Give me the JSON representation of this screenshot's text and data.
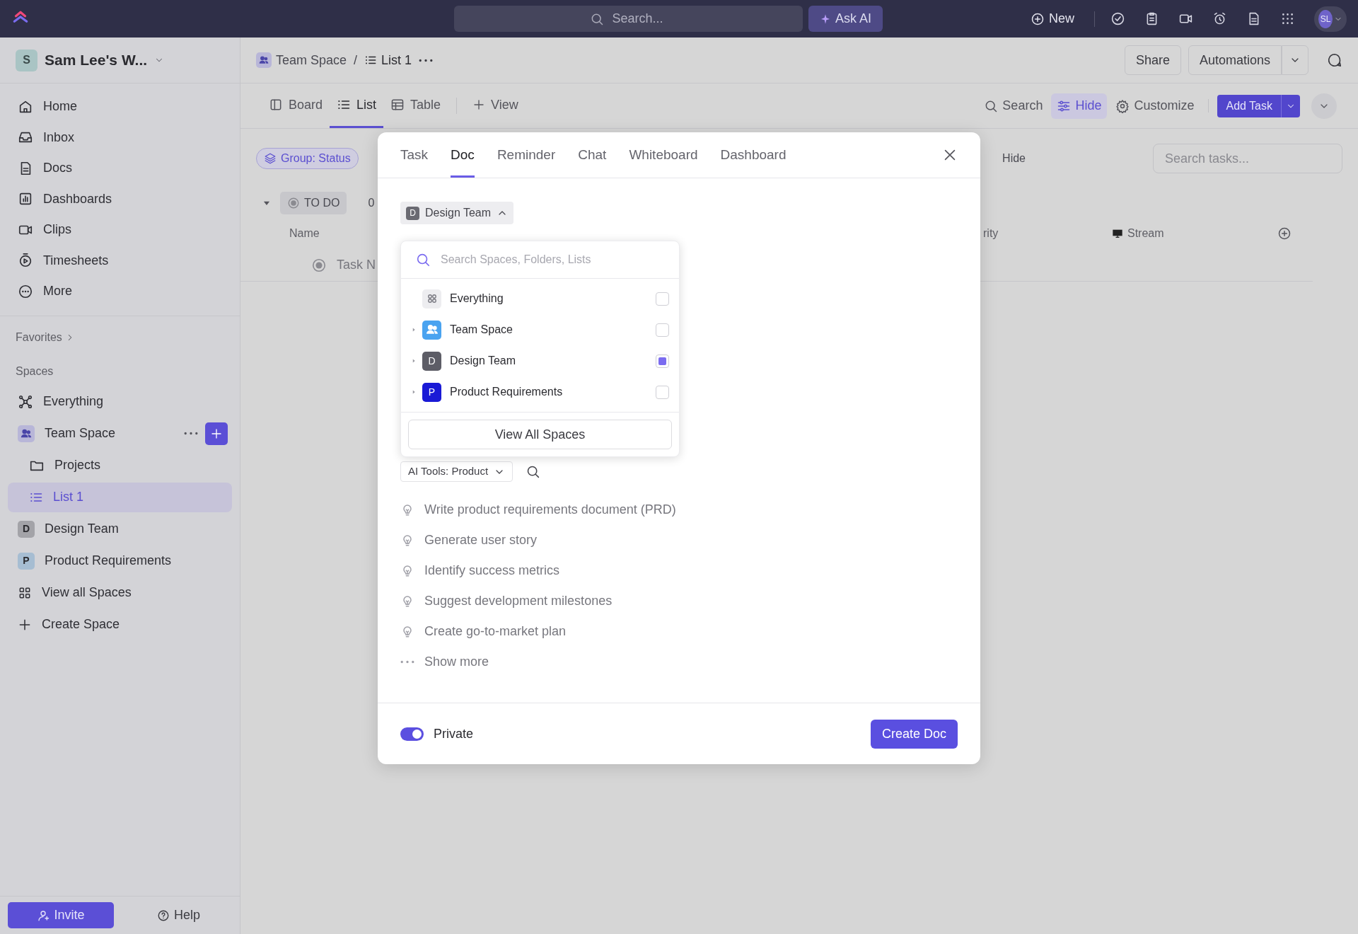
{
  "topbar": {
    "search": {
      "placeholder": "Search..."
    },
    "ask_ai": "Ask AI",
    "new": "New",
    "avatar": "SL"
  },
  "sidebar": {
    "workspace": {
      "initial": "S",
      "name": "Sam Lee's W..."
    },
    "nav": [
      {
        "label": "Home"
      },
      {
        "label": "Inbox"
      },
      {
        "label": "Docs"
      },
      {
        "label": "Dashboards"
      },
      {
        "label": "Clips"
      },
      {
        "label": "Timesheets"
      },
      {
        "label": "More"
      }
    ],
    "favorites": "Favorites",
    "spaces_heading": "Spaces",
    "spaces": [
      {
        "label": "Everything",
        "kind": "everything",
        "selected": false
      },
      {
        "label": "Team Space",
        "kind": "team",
        "selected": false,
        "children": [
          {
            "label": "Projects",
            "kind": "folder",
            "selected": false
          },
          {
            "label": "List 1",
            "kind": "list",
            "selected": true
          }
        ]
      },
      {
        "label": "Design Team",
        "kind": "avatar",
        "initial": "D",
        "color": "#a3a3a8",
        "selected": false
      },
      {
        "label": "Product Requirements",
        "kind": "avatar",
        "initial": "P",
        "color": "#a6bdd2",
        "selected": false
      },
      {
        "label": "View all Spaces",
        "kind": "grid",
        "selected": false
      },
      {
        "label": "Create Space",
        "kind": "plus",
        "selected": false
      }
    ],
    "invite": "Invite",
    "help": "Help"
  },
  "header": {
    "breadcrumb": [
      "Team Space",
      "List 1"
    ],
    "separator": "/",
    "share": "Share",
    "automations": "Automations"
  },
  "views": {
    "tabs": [
      {
        "label": "Board",
        "selected": false
      },
      {
        "label": "List",
        "selected": true
      },
      {
        "label": "Table",
        "selected": false
      }
    ],
    "add_view": "View",
    "tools": [
      {
        "label": "Search",
        "selected": false
      },
      {
        "label": "Hide",
        "selected": true
      },
      {
        "label": "Customize",
        "selected": false
      }
    ],
    "add_task": "Add Task"
  },
  "list": {
    "group_by": "Group: Status",
    "hide": "Hide",
    "search": {
      "placeholder": "Search tasks..."
    },
    "group": {
      "status": "TO DO",
      "count": "0",
      "expanded": true
    },
    "columns": [
      "Name",
      "rity",
      "Stream"
    ],
    "tasks": [
      "Task N"
    ]
  },
  "modal": {
    "tabs": [
      {
        "label": "Task",
        "selected": false
      },
      {
        "label": "Doc",
        "selected": true
      },
      {
        "label": "Reminder",
        "selected": false
      },
      {
        "label": "Chat",
        "selected": false
      },
      {
        "label": "Whiteboard",
        "selected": false
      },
      {
        "label": "Dashboard",
        "selected": false
      }
    ],
    "location": {
      "initial": "D",
      "name": "Design Team",
      "expanded": true
    },
    "picker": {
      "search": {
        "placeholder": "Search Spaces, Folders, Lists"
      },
      "items": [
        {
          "label": "Everything",
          "kind": "everything",
          "checked": false
        },
        {
          "label": "Team Space",
          "kind": "team",
          "checked": false
        },
        {
          "label": "Design Team",
          "kind": "avatar",
          "initial": "D",
          "color": "#5d5d66",
          "checked": true
        },
        {
          "label": "Product Requirements",
          "kind": "avatar",
          "initial": "P",
          "color": "#1a1ad6",
          "checked": false
        }
      ],
      "view_all": "View All Spaces"
    },
    "ai_tools": "AI Tools: Product",
    "suggestions": [
      "Write product requirements document (PRD)",
      "Generate user story",
      "Identify success metrics",
      "Suggest development milestones",
      "Create go-to-market plan"
    ],
    "show_more": "Show more",
    "private": {
      "label": "Private",
      "on": true
    },
    "create": "Create Doc"
  }
}
